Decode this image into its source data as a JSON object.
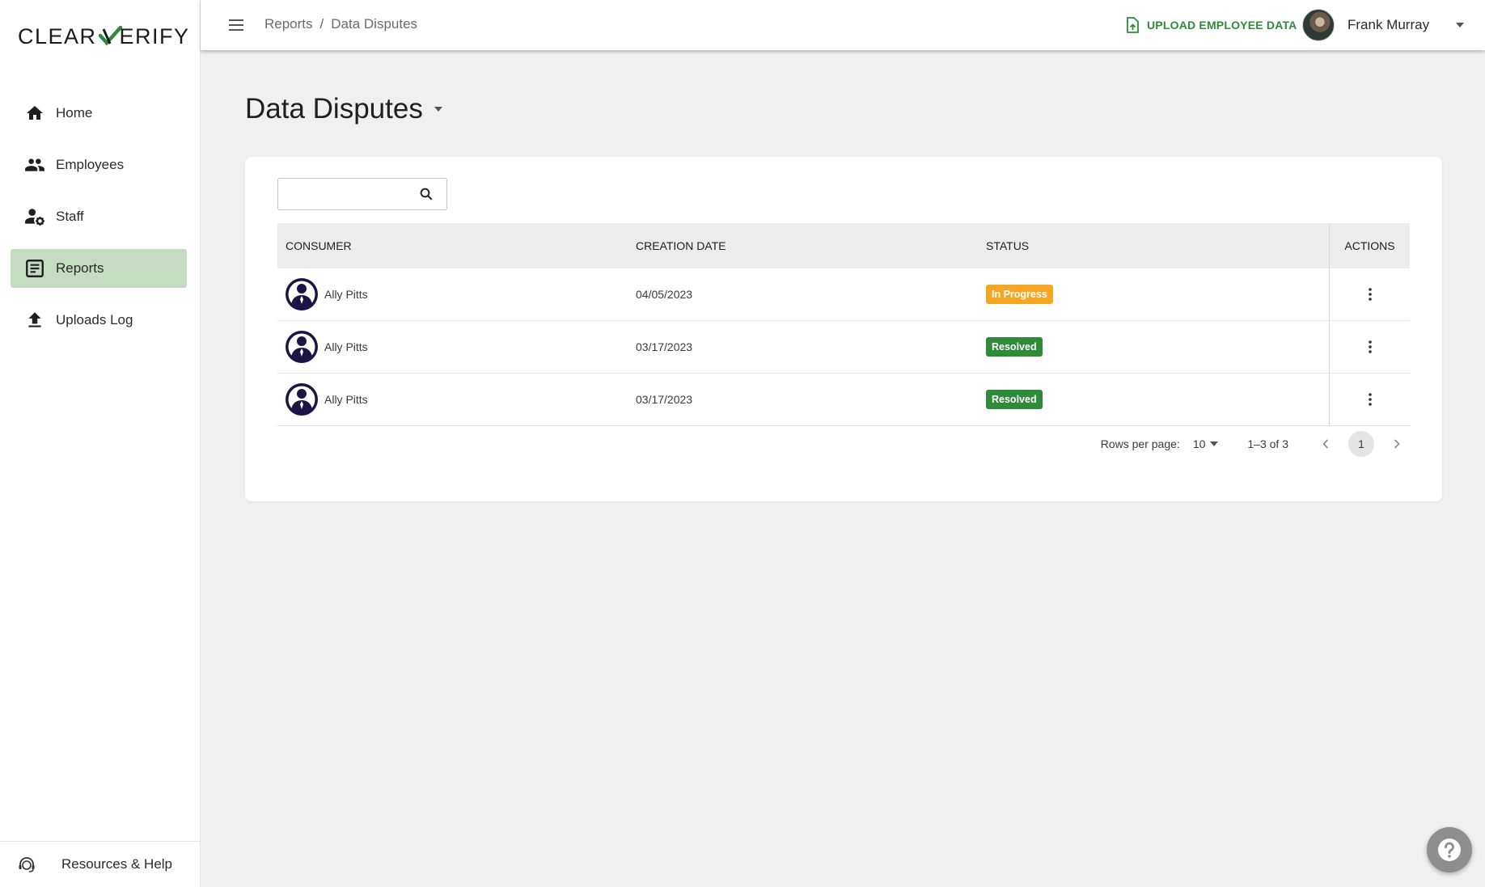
{
  "brand": {
    "logo_left": "CLEAR",
    "logo_right": "ERIFY",
    "check_color": "#2e8b3a"
  },
  "sidebar": {
    "items": [
      {
        "label": "Home",
        "icon": "home-icon"
      },
      {
        "label": "Employees",
        "icon": "people-icon"
      },
      {
        "label": "Staff",
        "icon": "staff-settings-icon"
      },
      {
        "label": "Reports",
        "icon": "report-icon",
        "active": true
      },
      {
        "label": "Uploads Log",
        "icon": "upload-icon"
      }
    ],
    "footer": {
      "label": "Resources & Help",
      "icon": "support-agent-icon"
    }
  },
  "topbar": {
    "breadcrumb": [
      "Reports",
      "/",
      "Data Disputes"
    ],
    "upload_label": "UPLOAD EMPLOYEE DATA",
    "user_name": "Frank Murray"
  },
  "page": {
    "title": "Data Disputes"
  },
  "search": {
    "placeholder": "",
    "value": ""
  },
  "table": {
    "headers": {
      "consumer": "CONSUMER",
      "creation_date": "CREATION DATE",
      "status": "STATUS",
      "actions": "ACTIONS"
    },
    "rows": [
      {
        "consumer": "Ally Pitts",
        "creation_date": "04/05/2023",
        "status": "In Progress",
        "status_color": "#f5a623"
      },
      {
        "consumer": "Ally Pitts",
        "creation_date": "03/17/2023",
        "status": "Resolved",
        "status_color": "#2e8b3a"
      },
      {
        "consumer": "Ally Pitts",
        "creation_date": "03/17/2023",
        "status": "Resolved",
        "status_color": "#2e8b3a"
      }
    ]
  },
  "pagination": {
    "rows_per_page_label": "Rows per page:",
    "rows_per_page": "10",
    "range": "1–3 of 3",
    "current_page": "1"
  },
  "colors": {
    "accent": "#2e8b3a",
    "active_nav": "#c5dcc3",
    "in_progress": "#f5a623",
    "avatar": "#1c1446"
  }
}
